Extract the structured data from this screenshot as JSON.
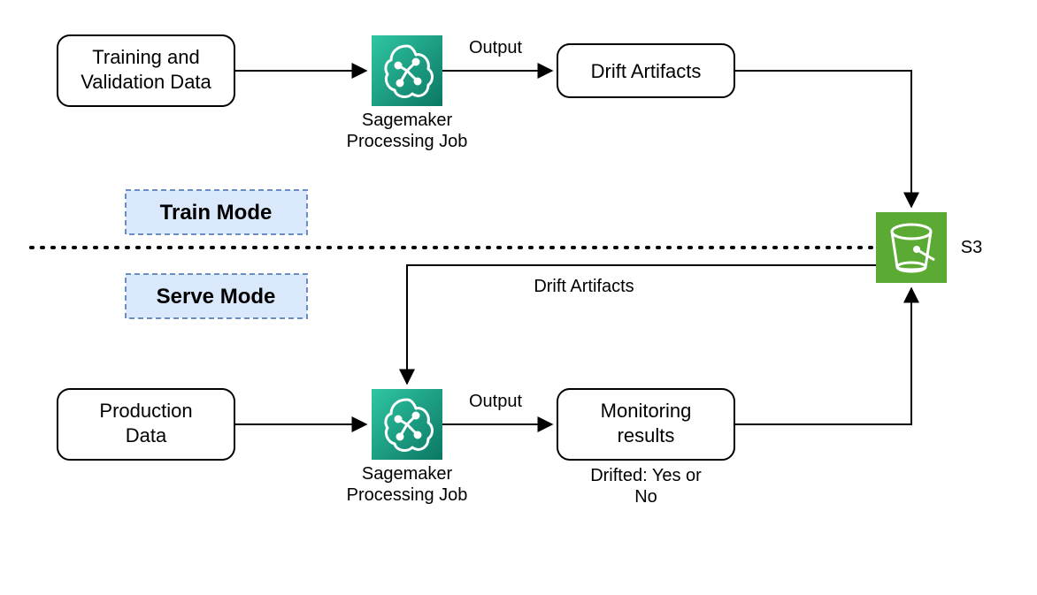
{
  "nodes": {
    "training_data": {
      "line1": "Training and",
      "line2": "Validation Data"
    },
    "drift_artifacts": "Drift Artifacts",
    "production_data": {
      "line1": "Production",
      "line2": "Data"
    },
    "monitoring_results": {
      "line1": "Monitoring",
      "line2": "results"
    }
  },
  "modes": {
    "train": "Train Mode",
    "serve": "Serve Mode"
  },
  "labels": {
    "sagemaker1_line1": "Sagemaker",
    "sagemaker1_line2": "Processing Job",
    "sagemaker2_line1": "Sagemaker",
    "sagemaker2_line2": "Processing Job",
    "output1": "Output",
    "output2": "Output",
    "drift_artifacts_edge": "Drift Artifacts",
    "drifted_line1": "Drifted: Yes or",
    "drifted_line2": "No",
    "s3": "S3"
  },
  "icons": {
    "sagemaker": "sagemaker-icon",
    "s3": "s3-bucket-icon"
  },
  "colors": {
    "sagemaker_grad_a": "#2fc6a3",
    "sagemaker_grad_b": "#0b7763",
    "s3_fill": "#5aaa33",
    "mode_fill": "#dae8fc",
    "mode_stroke": "#6c8ebf"
  }
}
